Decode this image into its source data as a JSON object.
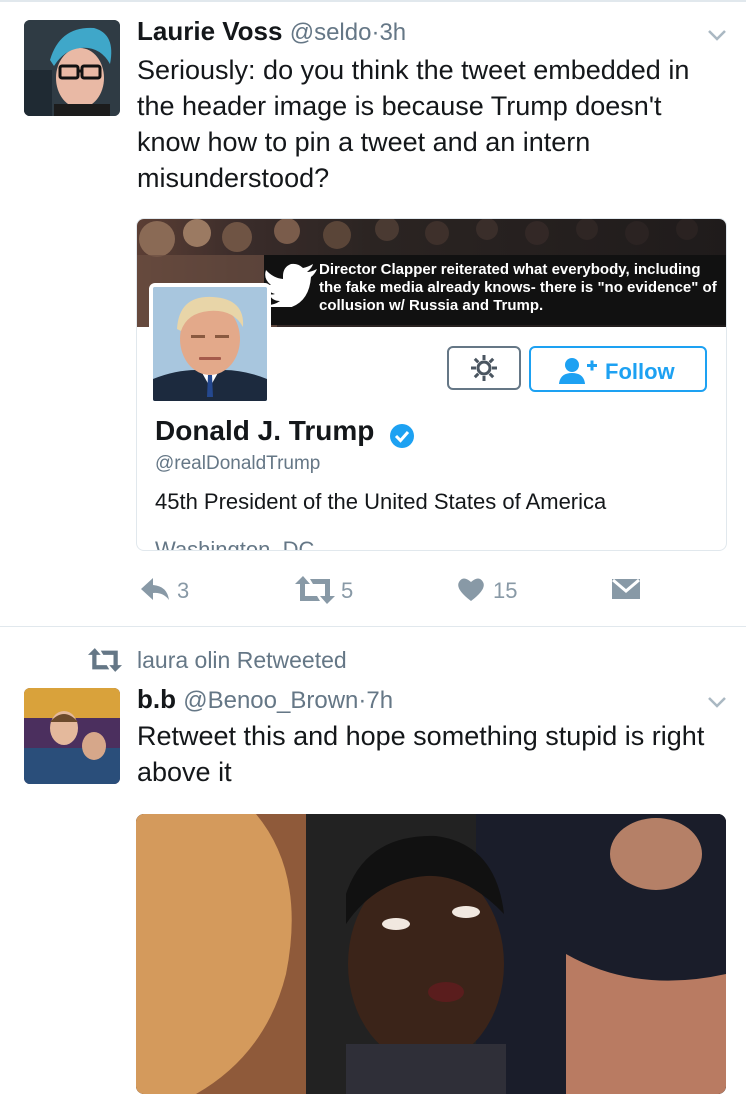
{
  "tweets": [
    {
      "name": "Laurie Voss",
      "handle": "@seldo",
      "separator": "·",
      "time": "3h",
      "text": "Seriously: do you think the tweet embedded in the header image is because Trump doesn't know how to pin a tweet and an intern misunderstood?",
      "card": {
        "banner_quote": "Director Clapper reiterated what everybody, including the fake media already knows- there is \"no evidence\" of collusion w/ Russia and Trump.",
        "follow_label": "Follow",
        "name": "Donald J. Trump",
        "handle": "@realDonaldTrump",
        "bio": "45th President of the United States of America",
        "location": "Washington, DC"
      },
      "actions": {
        "replies": "3",
        "retweets": "5",
        "likes": "15"
      }
    },
    {
      "retweeted_by": "laura olin Retweeted",
      "name": "b.b",
      "handle": "@Benoo_Brown",
      "separator": "·",
      "time": "7h",
      "text": "Retweet this and hope something stupid is right above it"
    }
  ],
  "colors": {
    "accent": "#1da1f2",
    "muted": "#657786",
    "icon": "#8899a6",
    "text": "#14171a"
  },
  "icons": [
    "chevron-down-icon",
    "twitter-bird-icon",
    "gear-icon",
    "add-user-icon",
    "verified-icon",
    "reply-icon",
    "retweet-icon",
    "heart-icon",
    "message-icon"
  ]
}
